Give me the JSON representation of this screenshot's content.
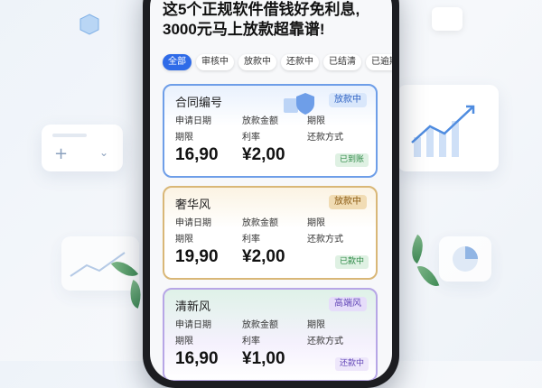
{
  "headline": {
    "line1": "这5个正规软件借钱好免利息,",
    "line2": "3000元马上放款超靠谱!"
  },
  "tabs": [
    {
      "label": "全部",
      "active": true
    },
    {
      "label": "审核中",
      "active": false
    },
    {
      "label": "放款中",
      "active": false
    },
    {
      "label": "还款中",
      "active": false
    },
    {
      "label": "已结清",
      "active": false
    },
    {
      "label": "已逾期",
      "active": false
    }
  ],
  "cards": [
    {
      "title": "合同编号",
      "badge": "放款中",
      "labels": {
        "apply_date": "申请日期",
        "amount": "放款金额",
        "term_top": "期限",
        "term": "期限",
        "rate": "利率",
        "repay": "还款方式"
      },
      "term_value": "16,90",
      "rate_value": "¥2,00",
      "status": "已到账"
    },
    {
      "title": "奢华风",
      "badge": "放款中",
      "labels": {
        "apply_date": "申请日期",
        "amount": "放款金额",
        "term_top": "期限",
        "term": "期限",
        "rate": "利率",
        "repay": "还款方式"
      },
      "term_value": "19,90",
      "rate_value": "¥2,00",
      "status": "已款中"
    },
    {
      "title": "清新风",
      "badge": "高端风",
      "labels": {
        "apply_date": "申请日期",
        "amount": "放款金额",
        "term_top": "期限",
        "term": "期限",
        "rate": "利率",
        "repay": "还款方式"
      },
      "term_value": "16,90",
      "rate_value": "¥1,00",
      "status": "还款中"
    }
  ],
  "colors": {
    "accent": "#2f6be8",
    "card_blue": "#6e9ee8",
    "card_gold": "#d9b777",
    "card_purple": "#b7a6e6"
  }
}
